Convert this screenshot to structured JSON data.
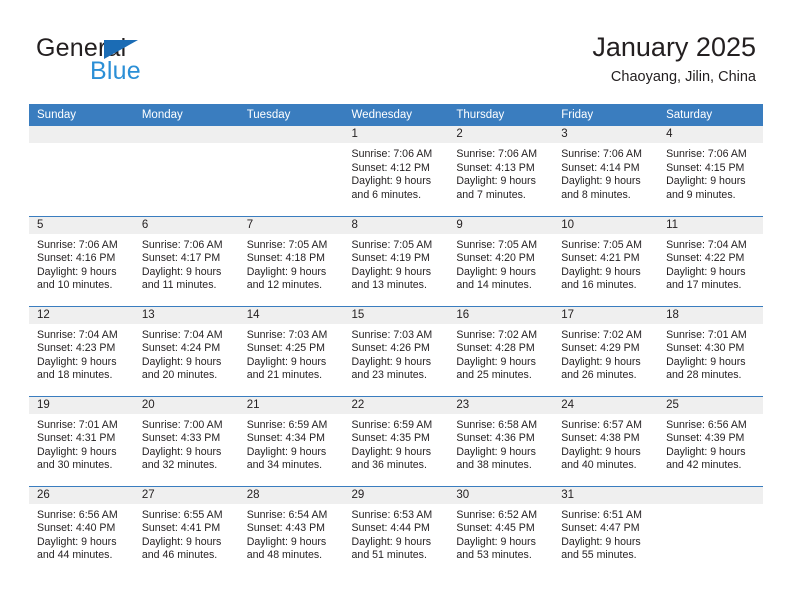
{
  "brand": {
    "name_top": "General",
    "name_bottom": "Blue",
    "triangle_color": "#1b6cb5",
    "blue_text_color": "#2b8fd6"
  },
  "header": {
    "title": "January 2025",
    "subtitle": "Chaoyang, Jilin, China"
  },
  "theme": {
    "header_bar": "#3a7dbf",
    "daynum_band": "#efefef",
    "text": "#231f20"
  },
  "weekdays": [
    "Sunday",
    "Monday",
    "Tuesday",
    "Wednesday",
    "Thursday",
    "Friday",
    "Saturday"
  ],
  "weeks": [
    [
      {
        "day": "",
        "lines": []
      },
      {
        "day": "",
        "lines": []
      },
      {
        "day": "",
        "lines": []
      },
      {
        "day": "1",
        "lines": [
          "Sunrise: 7:06 AM",
          "Sunset: 4:12 PM",
          "Daylight: 9 hours",
          "and 6 minutes."
        ]
      },
      {
        "day": "2",
        "lines": [
          "Sunrise: 7:06 AM",
          "Sunset: 4:13 PM",
          "Daylight: 9 hours",
          "and 7 minutes."
        ]
      },
      {
        "day": "3",
        "lines": [
          "Sunrise: 7:06 AM",
          "Sunset: 4:14 PM",
          "Daylight: 9 hours",
          "and 8 minutes."
        ]
      },
      {
        "day": "4",
        "lines": [
          "Sunrise: 7:06 AM",
          "Sunset: 4:15 PM",
          "Daylight: 9 hours",
          "and 9 minutes."
        ]
      }
    ],
    [
      {
        "day": "5",
        "lines": [
          "Sunrise: 7:06 AM",
          "Sunset: 4:16 PM",
          "Daylight: 9 hours",
          "and 10 minutes."
        ]
      },
      {
        "day": "6",
        "lines": [
          "Sunrise: 7:06 AM",
          "Sunset: 4:17 PM",
          "Daylight: 9 hours",
          "and 11 minutes."
        ]
      },
      {
        "day": "7",
        "lines": [
          "Sunrise: 7:05 AM",
          "Sunset: 4:18 PM",
          "Daylight: 9 hours",
          "and 12 minutes."
        ]
      },
      {
        "day": "8",
        "lines": [
          "Sunrise: 7:05 AM",
          "Sunset: 4:19 PM",
          "Daylight: 9 hours",
          "and 13 minutes."
        ]
      },
      {
        "day": "9",
        "lines": [
          "Sunrise: 7:05 AM",
          "Sunset: 4:20 PM",
          "Daylight: 9 hours",
          "and 14 minutes."
        ]
      },
      {
        "day": "10",
        "lines": [
          "Sunrise: 7:05 AM",
          "Sunset: 4:21 PM",
          "Daylight: 9 hours",
          "and 16 minutes."
        ]
      },
      {
        "day": "11",
        "lines": [
          "Sunrise: 7:04 AM",
          "Sunset: 4:22 PM",
          "Daylight: 9 hours",
          "and 17 minutes."
        ]
      }
    ],
    [
      {
        "day": "12",
        "lines": [
          "Sunrise: 7:04 AM",
          "Sunset: 4:23 PM",
          "Daylight: 9 hours",
          "and 18 minutes."
        ]
      },
      {
        "day": "13",
        "lines": [
          "Sunrise: 7:04 AM",
          "Sunset: 4:24 PM",
          "Daylight: 9 hours",
          "and 20 minutes."
        ]
      },
      {
        "day": "14",
        "lines": [
          "Sunrise: 7:03 AM",
          "Sunset: 4:25 PM",
          "Daylight: 9 hours",
          "and 21 minutes."
        ]
      },
      {
        "day": "15",
        "lines": [
          "Sunrise: 7:03 AM",
          "Sunset: 4:26 PM",
          "Daylight: 9 hours",
          "and 23 minutes."
        ]
      },
      {
        "day": "16",
        "lines": [
          "Sunrise: 7:02 AM",
          "Sunset: 4:28 PM",
          "Daylight: 9 hours",
          "and 25 minutes."
        ]
      },
      {
        "day": "17",
        "lines": [
          "Sunrise: 7:02 AM",
          "Sunset: 4:29 PM",
          "Daylight: 9 hours",
          "and 26 minutes."
        ]
      },
      {
        "day": "18",
        "lines": [
          "Sunrise: 7:01 AM",
          "Sunset: 4:30 PM",
          "Daylight: 9 hours",
          "and 28 minutes."
        ]
      }
    ],
    [
      {
        "day": "19",
        "lines": [
          "Sunrise: 7:01 AM",
          "Sunset: 4:31 PM",
          "Daylight: 9 hours",
          "and 30 minutes."
        ]
      },
      {
        "day": "20",
        "lines": [
          "Sunrise: 7:00 AM",
          "Sunset: 4:33 PM",
          "Daylight: 9 hours",
          "and 32 minutes."
        ]
      },
      {
        "day": "21",
        "lines": [
          "Sunrise: 6:59 AM",
          "Sunset: 4:34 PM",
          "Daylight: 9 hours",
          "and 34 minutes."
        ]
      },
      {
        "day": "22",
        "lines": [
          "Sunrise: 6:59 AM",
          "Sunset: 4:35 PM",
          "Daylight: 9 hours",
          "and 36 minutes."
        ]
      },
      {
        "day": "23",
        "lines": [
          "Sunrise: 6:58 AM",
          "Sunset: 4:36 PM",
          "Daylight: 9 hours",
          "and 38 minutes."
        ]
      },
      {
        "day": "24",
        "lines": [
          "Sunrise: 6:57 AM",
          "Sunset: 4:38 PM",
          "Daylight: 9 hours",
          "and 40 minutes."
        ]
      },
      {
        "day": "25",
        "lines": [
          "Sunrise: 6:56 AM",
          "Sunset: 4:39 PM",
          "Daylight: 9 hours",
          "and 42 minutes."
        ]
      }
    ],
    [
      {
        "day": "26",
        "lines": [
          "Sunrise: 6:56 AM",
          "Sunset: 4:40 PM",
          "Daylight: 9 hours",
          "and 44 minutes."
        ]
      },
      {
        "day": "27",
        "lines": [
          "Sunrise: 6:55 AM",
          "Sunset: 4:41 PM",
          "Daylight: 9 hours",
          "and 46 minutes."
        ]
      },
      {
        "day": "28",
        "lines": [
          "Sunrise: 6:54 AM",
          "Sunset: 4:43 PM",
          "Daylight: 9 hours",
          "and 48 minutes."
        ]
      },
      {
        "day": "29",
        "lines": [
          "Sunrise: 6:53 AM",
          "Sunset: 4:44 PM",
          "Daylight: 9 hours",
          "and 51 minutes."
        ]
      },
      {
        "day": "30",
        "lines": [
          "Sunrise: 6:52 AM",
          "Sunset: 4:45 PM",
          "Daylight: 9 hours",
          "and 53 minutes."
        ]
      },
      {
        "day": "31",
        "lines": [
          "Sunrise: 6:51 AM",
          "Sunset: 4:47 PM",
          "Daylight: 9 hours",
          "and 55 minutes."
        ]
      },
      {
        "day": "",
        "lines": []
      }
    ]
  ]
}
